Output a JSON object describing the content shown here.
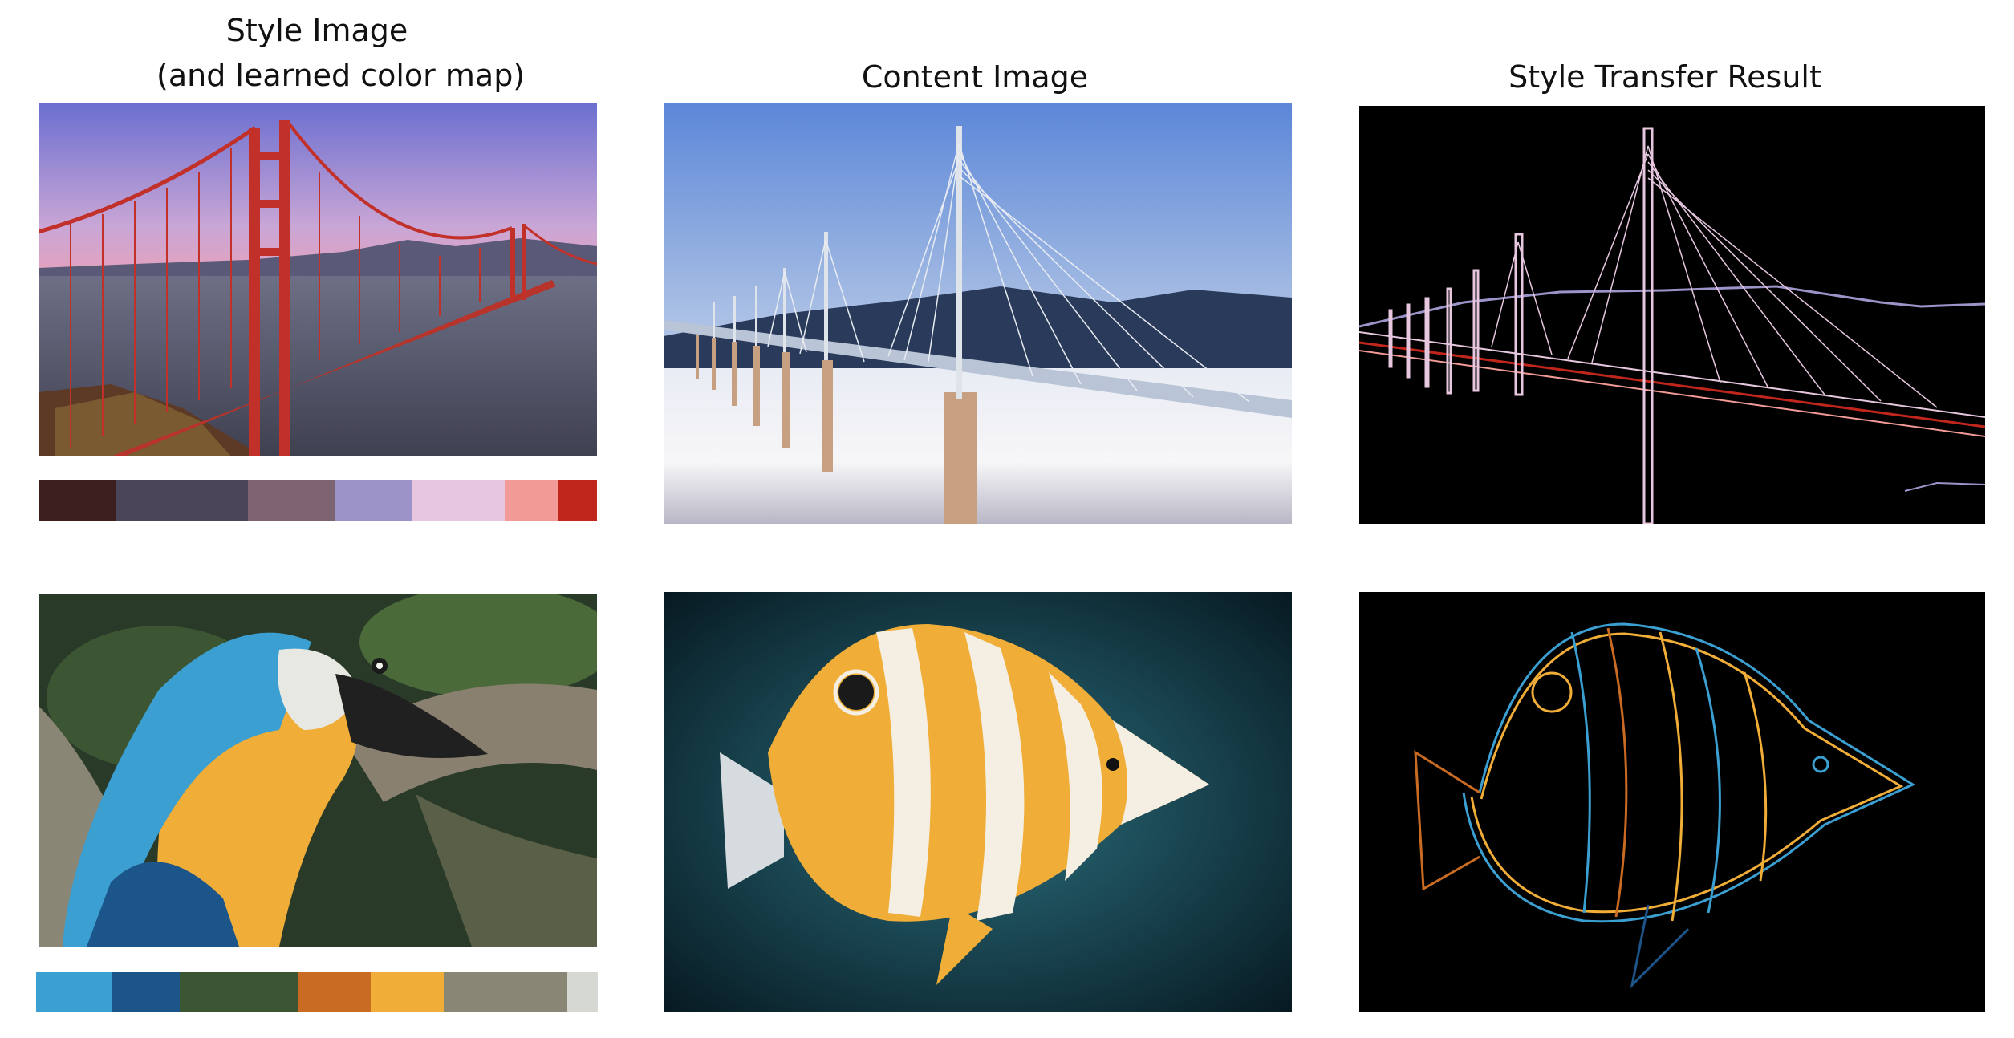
{
  "titles": {
    "style_line1": "Style Image",
    "style_line2": "(and learned color map)",
    "content": "Content Image",
    "result": "Style Transfer Result"
  },
  "rows": [
    {
      "palette": [
        {
          "color": "#3e1f1f",
          "weight": 0.14
        },
        {
          "color": "#4a4559",
          "weight": 0.235
        },
        {
          "color": "#7d6470",
          "weight": 0.155
        },
        {
          "color": "#9c93c9",
          "weight": 0.14
        },
        {
          "color": "#e6c7df",
          "weight": 0.165
        },
        {
          "color": "#f29a96",
          "weight": 0.095
        },
        {
          "color": "#c0261c",
          "weight": 0.07
        }
      ]
    },
    {
      "palette": [
        {
          "color": "#3b9fd1",
          "weight": 0.135
        },
        {
          "color": "#1c5589",
          "weight": 0.12
        },
        {
          "color": "#3c5634",
          "weight": 0.21
        },
        {
          "color": "#c96b22",
          "weight": 0.13
        },
        {
          "color": "#f0ad38",
          "weight": 0.13
        },
        {
          "color": "#898675",
          "weight": 0.22
        },
        {
          "color": "#d6d8d4",
          "weight": 0.055
        }
      ]
    }
  ]
}
